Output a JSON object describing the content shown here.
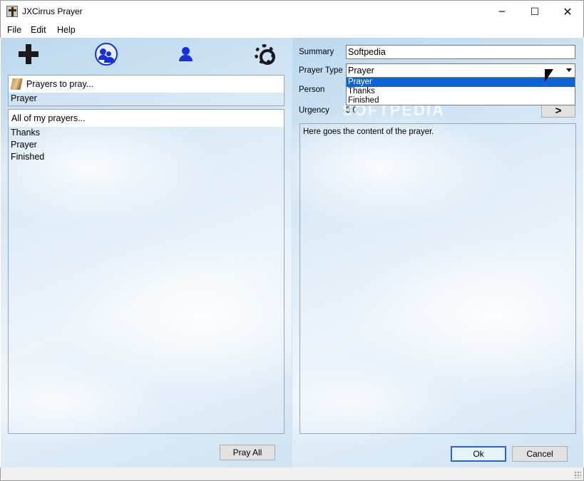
{
  "window": {
    "title": "JXCirrus Prayer",
    "controls": {
      "minimize": "─",
      "maximize": "☐",
      "close": "✕"
    }
  },
  "menu": {
    "items": [
      "File",
      "Edit",
      "Help"
    ]
  },
  "toolbar": {
    "icons": [
      "plus-icon",
      "group-icon",
      "person-icon",
      "gear-icon"
    ],
    "accent_color": "#1530e0"
  },
  "left": {
    "prayer_list": {
      "header": "Prayers to pray...",
      "rows": [
        "Prayer"
      ]
    },
    "filter_list": {
      "header": "All of my prayers...",
      "rows": [
        "Thanks",
        "Prayer",
        "Finished"
      ]
    },
    "pray_all_label": "Pray All"
  },
  "form": {
    "summary_label": "Summary",
    "summary_value": "Softpedia",
    "type_label": "Prayer Type",
    "type_value": "Prayer",
    "type_options": [
      "Prayer",
      "Thanks",
      "Finished"
    ],
    "selected_option": "Prayer",
    "person_label": "Person",
    "urgency_label": "Urgency",
    "urgency_value": "5.0",
    "next_label": ">",
    "content": "Here goes the content of the prayer.",
    "ok_label": "Ok",
    "cancel_label": "Cancel"
  },
  "watermark": "SOFTPEDIA"
}
